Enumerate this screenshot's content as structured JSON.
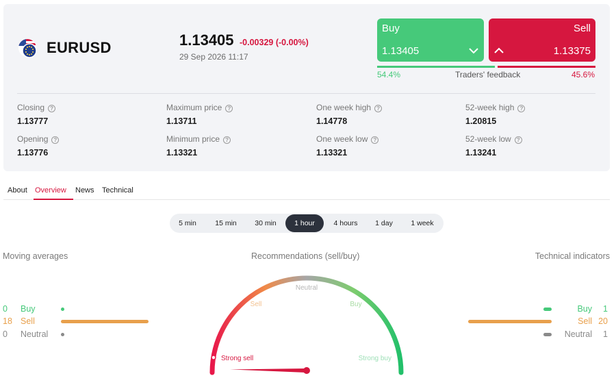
{
  "instrument": {
    "flag_icon": "eu-us-flag-icon",
    "symbol": "EURUSD",
    "price": "1.13405",
    "change": "-0.00329 (-0.00%)",
    "datetime": "29 Sep 2026 11:17"
  },
  "trade": {
    "buy_label": "Buy",
    "buy_price": "1.13405",
    "buy_icon": "chevron-down-icon",
    "sell_label": "Sell",
    "sell_price": "1.13375",
    "sell_icon": "chevron-up-icon",
    "feedback_label": "Traders' feedback",
    "buy_percent_text": "54.4%",
    "sell_percent_text": "45.6%",
    "buy_fraction": 0.544
  },
  "stats": [
    {
      "label": "Closing",
      "value": "1.13777"
    },
    {
      "label": "Maximum price",
      "value": "1.13711"
    },
    {
      "label": "One week high",
      "value": "1.14778"
    },
    {
      "label": "52-week high",
      "value": "1.20815"
    },
    {
      "label": "Opening",
      "value": "1.13776"
    },
    {
      "label": "Minimum price",
      "value": "1.13321"
    },
    {
      "label": "One week low",
      "value": "1.13321"
    },
    {
      "label": "52-week low",
      "value": "1.13241"
    }
  ],
  "tabs": [
    "About",
    "Overview",
    "News",
    "Technical"
  ],
  "active_tab": "Overview",
  "timeframes": [
    "5 min",
    "15 min",
    "30 min",
    "1 hour",
    "4 hours",
    "1 day",
    "1 week"
  ],
  "active_timeframe": "1 hour",
  "moving_averages": {
    "title": "Moving averages",
    "rows": [
      {
        "count": "0",
        "label": "Buy",
        "fraction": 0.0
      },
      {
        "count": "18",
        "label": "Sell",
        "fraction": 1.0
      },
      {
        "count": "0",
        "label": "Neutral",
        "fraction": 0.0
      }
    ]
  },
  "recommendations": {
    "title": "Recommendations (sell/buy)",
    "labels": {
      "strong_sell": "Strong sell",
      "sell": "Sell",
      "neutral": "Neutral",
      "buy": "Buy",
      "strong_buy": "Strong buy"
    },
    "needle_fraction": 0.03
  },
  "technical_indicators": {
    "title": "Technical indicators",
    "rows": [
      {
        "count": "1",
        "label": "Buy",
        "fraction": 0.05
      },
      {
        "count": "20",
        "label": "Sell",
        "fraction": 1.0
      },
      {
        "count": "1",
        "label": "Neutral",
        "fraction": 0.05
      }
    ]
  },
  "colors": {
    "buy": "#46c97a",
    "sell": "#d6173f",
    "orange": "#e8a04c",
    "neutral": "#8a8a8a",
    "dark_pill": "#2c313c"
  }
}
